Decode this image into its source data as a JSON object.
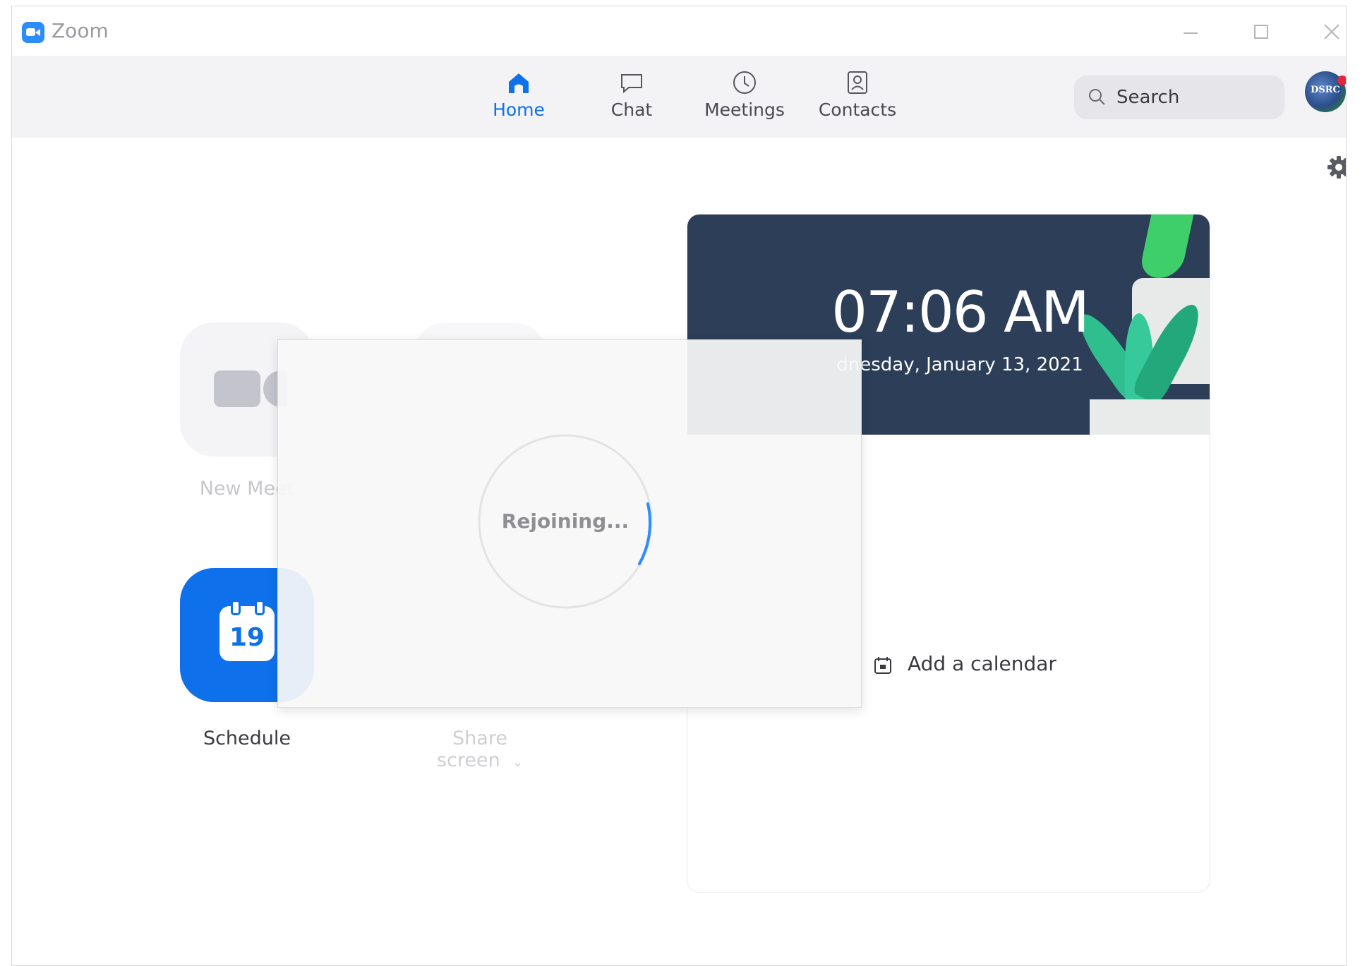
{
  "window": {
    "title": "Zoom"
  },
  "nav": {
    "tabs": [
      {
        "label": "Home",
        "icon": "home-icon",
        "active": true
      },
      {
        "label": "Chat",
        "icon": "chat-bubble-icon",
        "active": false
      },
      {
        "label": "Meetings",
        "icon": "clock-icon",
        "active": false
      },
      {
        "label": "Contacts",
        "icon": "contact-card-icon",
        "active": false
      }
    ],
    "search_placeholder": "Search",
    "avatar_text": "DSRC"
  },
  "actions": {
    "new_meeting": "New Meet",
    "schedule": "Schedule",
    "schedule_day": "19",
    "share_screen": "Share screen"
  },
  "calendar_card": {
    "time": "07:06 AM",
    "date": "dnesday, January 13, 2021",
    "add_calendar": "Add a calendar"
  },
  "overlay": {
    "status": "Rejoining..."
  },
  "colors": {
    "accent": "#0e71eb",
    "nav_bg": "#f3f3f5",
    "banner_bg": "#2c3e58"
  }
}
